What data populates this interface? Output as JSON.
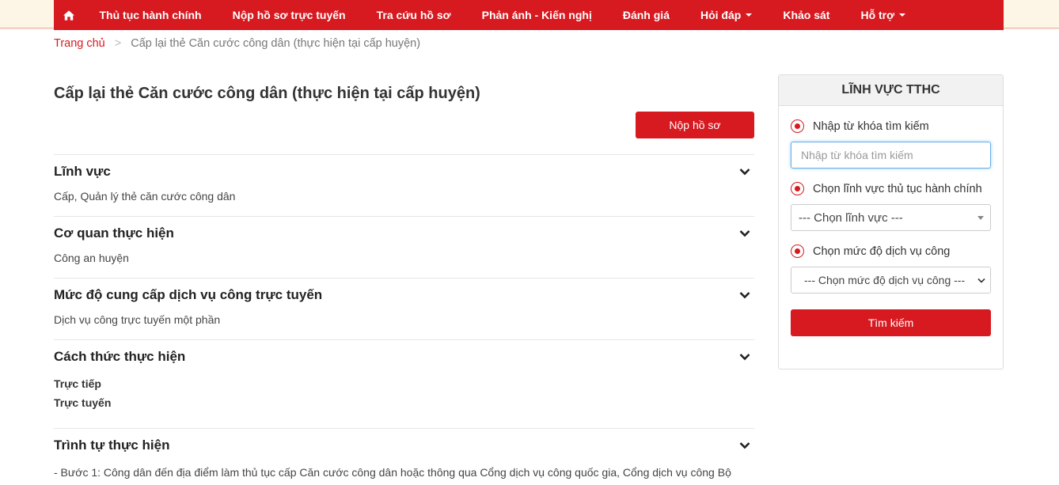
{
  "nav": {
    "home_icon": "home-icon",
    "items": [
      {
        "label": "Thủ tục hành chính",
        "dropdown": false
      },
      {
        "label": "Nộp hồ sơ trực tuyến",
        "dropdown": false
      },
      {
        "label": "Tra cứu hồ sơ",
        "dropdown": false
      },
      {
        "label": "Phản ánh - Kiến nghị",
        "dropdown": false
      },
      {
        "label": "Đánh giá",
        "dropdown": false
      },
      {
        "label": "Hỏi đáp",
        "dropdown": true
      },
      {
        "label": "Khảo sát",
        "dropdown": false
      },
      {
        "label": "Hỗ trợ",
        "dropdown": true
      }
    ]
  },
  "breadcrumb": {
    "home": "Trang chủ",
    "separator": ">",
    "current": "Cấp lại thẻ Căn cước công dân (thực hiện tại cấp huyện)"
  },
  "main": {
    "title": "Cấp lại thẻ Căn cước công dân (thực hiện tại cấp huyện)",
    "submit_label": "Nộp hồ sơ",
    "sections": [
      {
        "title": "Lĩnh vực",
        "body": "Cấp, Quản lý thẻ căn cước công dân"
      },
      {
        "title": "Cơ quan thực hiện",
        "body": "Công an huyện"
      },
      {
        "title": "Mức độ cung cấp dịch vụ công trực tuyến",
        "body": "Dịch vụ công trực tuyến một phần"
      },
      {
        "title": "Cách thức thực hiện",
        "lines": [
          "Trực tiếp",
          "Trực tuyến"
        ]
      },
      {
        "title": "Trình tự thực hiện",
        "body": "- Bước 1: Công dân đến địa điểm làm thủ tục cấp Căn cước công dân hoặc thông qua Cổng dịch vụ công quốc gia, Cổng dịch vụ công Bộ"
      }
    ]
  },
  "sidebar": {
    "title": "LĨNH VỰC TTHC",
    "keyword_label": "Nhập từ khóa tìm kiếm",
    "keyword_placeholder": "Nhập từ khóa tìm kiếm",
    "field_label": "Chọn lĩnh vực thủ tục hành chính",
    "field_selected": "--- Chọn lĩnh vực ---",
    "level_label": "Chọn mức độ dịch vụ công",
    "level_selected": "--- Chọn mức độ dịch vụ công ---",
    "search_label": "Tìm kiếm"
  },
  "colors": {
    "accent": "#d71920",
    "side_stripe": "#fdf6e6"
  }
}
